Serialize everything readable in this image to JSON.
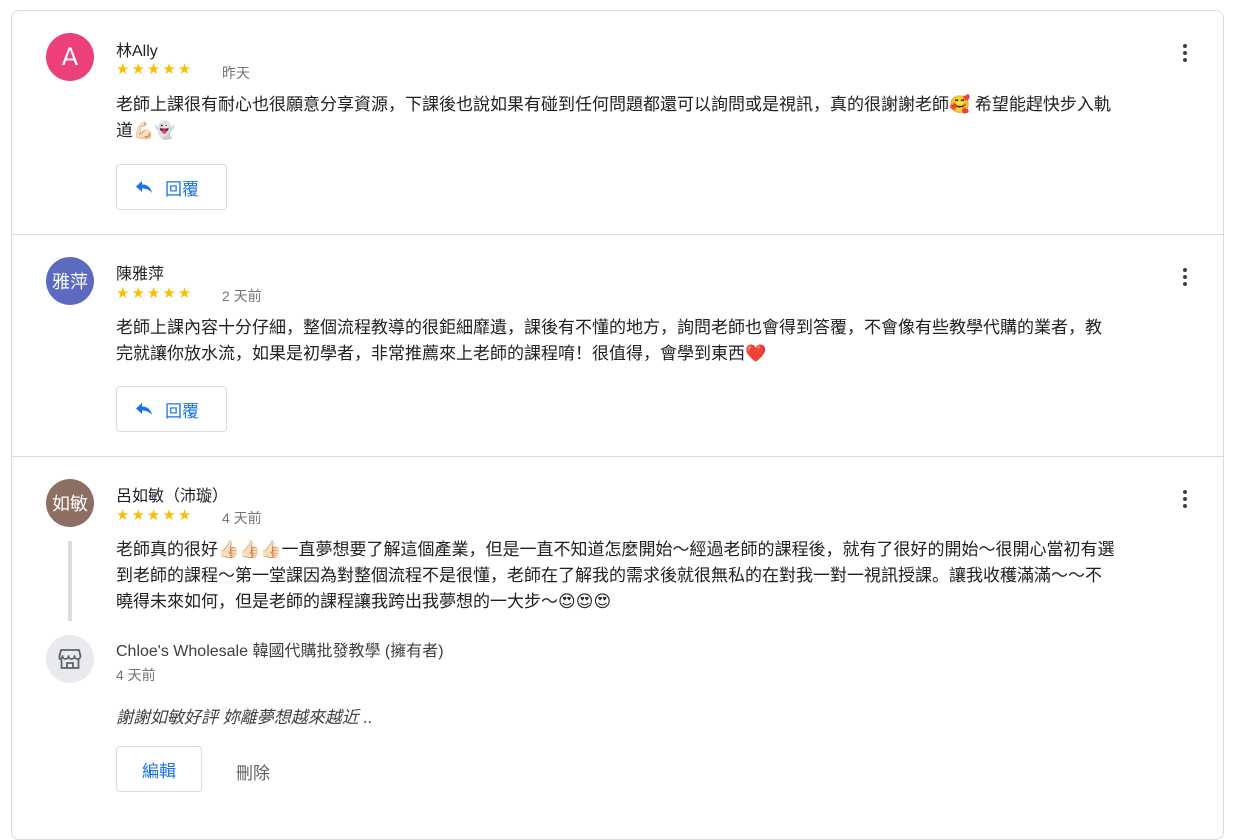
{
  "reviews": [
    {
      "avatar_text": "A",
      "avatar_color": "#ec407a",
      "name": "林Ally",
      "stars": "★★★★★",
      "date": "昨天",
      "text": "老師上課很有耐心也很願意分享資源，下課後也說如果有碰到任何問題都還可以詢問或是視訊，真的很謝謝老師🥰 希望能趕快步入軌道💪🏻👻",
      "reply_label": "回覆"
    },
    {
      "avatar_text": "雅萍",
      "avatar_color": "#5c6bc0",
      "name": "陳雅萍",
      "stars": "★★★★★",
      "date": "2 天前",
      "text": "老師上課內容十分仔細，整個流程教導的很鉅細靡遺，課後有不懂的地方，詢問老師也會得到答覆，不會像有些教學代購的業者，教完就讓你放水流，如果是初學者，非常推薦來上老師的課程唷！很值得，會學到東西❤️",
      "reply_label": "回覆"
    },
    {
      "avatar_text": "如敏",
      "avatar_color": "#8d6e63",
      "name": "呂如敏（沛璇）",
      "stars": "★★★★★",
      "date": "4 天前",
      "text": "老師真的很好👍🏻👍🏻👍🏻一直夢想要了解這個產業，但是一直不知道怎麼開始～經過老師的課程後，就有了很好的開始～很開心當初有選到老師的課程～第一堂課因為對整個流程不是很懂，老師在了解我的需求後就很無私的在對我一對一視訊授課。讓我收穫滿滿～～不曉得未來如何，但是老師的課程讓我跨出我夢想的一大步～😍😍😍"
    }
  ],
  "owner_reply": {
    "name": "Chloe's Wholesale 韓國代購批發教學 (擁有者)",
    "date": "4 天前",
    "text": "謝謝如敏好評 妳離夢想越來越近 ..",
    "edit_label": "編輯",
    "delete_label": "刪除"
  }
}
